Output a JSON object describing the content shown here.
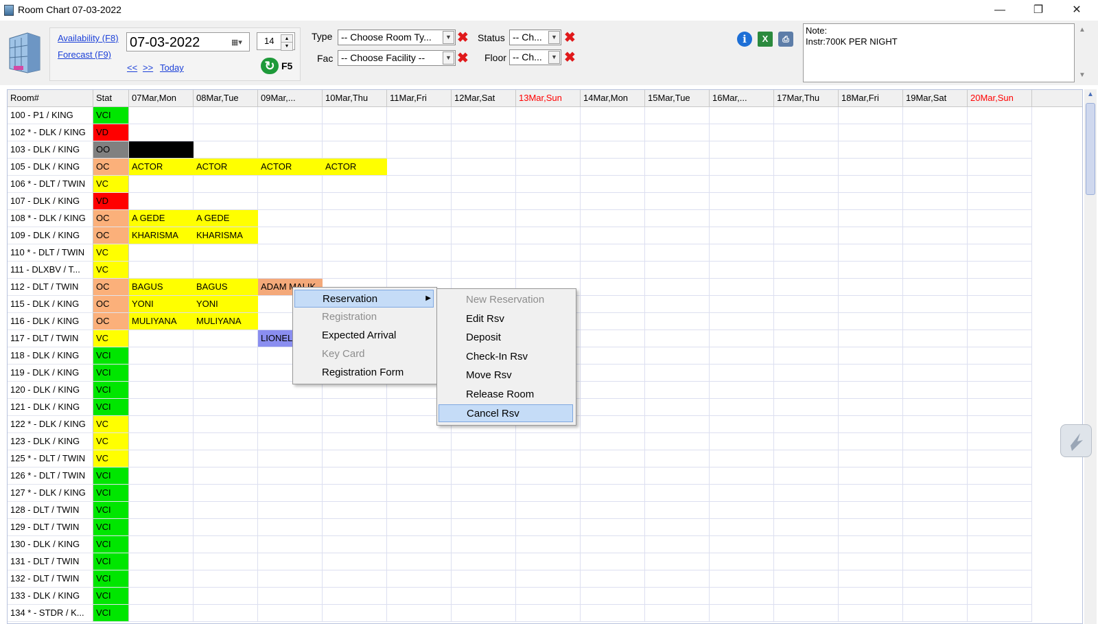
{
  "window": {
    "title": "Room Chart 07-03-2022",
    "minimize": "—",
    "restore": "❐",
    "close": "✕"
  },
  "toolbar": {
    "availability_link": "Availability (F8)",
    "forecast_link": "Forecast (F9)",
    "prev_link": "<<",
    "next_link": ">>",
    "today_link": "Today",
    "date_value": "07-03-2022",
    "days_value": "14",
    "refresh_label": "F5",
    "type_label": "Type",
    "type_value": "-- Choose Room Ty...",
    "fac_label": "Fac",
    "fac_value": "-- Choose Facility --",
    "status_label": "Status",
    "status_value": "-- Ch...",
    "floor_label": "Floor",
    "floor_value": "-- Ch...",
    "note_line1": "Note:",
    "note_line2": "Instr:700K PER NIGHT"
  },
  "grid": {
    "col_room": "Room#",
    "col_stat": "Stat",
    "dates": [
      {
        "label": "07Mar,Mon",
        "weekend": false
      },
      {
        "label": "08Mar,Tue",
        "weekend": false
      },
      {
        "label": "09Mar,...",
        "weekend": false
      },
      {
        "label": "10Mar,Thu",
        "weekend": false
      },
      {
        "label": "11Mar,Fri",
        "weekend": false
      },
      {
        "label": "12Mar,Sat",
        "weekend": false
      },
      {
        "label": "13Mar,Sun",
        "weekend": true
      },
      {
        "label": "14Mar,Mon",
        "weekend": false
      },
      {
        "label": "15Mar,Tue",
        "weekend": false
      },
      {
        "label": "16Mar,...",
        "weekend": false
      },
      {
        "label": "17Mar,Thu",
        "weekend": false
      },
      {
        "label": "18Mar,Fri",
        "weekend": false
      },
      {
        "label": "19Mar,Sat",
        "weekend": false
      },
      {
        "label": "20Mar,Sun",
        "weekend": true
      }
    ],
    "rows": [
      {
        "room": "100 - P1 / KING",
        "stat": "VCI"
      },
      {
        "room": "102 * - DLK / KING",
        "stat": "VD"
      },
      {
        "room": "103 - DLK / KING",
        "stat": "OO"
      },
      {
        "room": "105 - DLK / KING",
        "stat": "OC"
      },
      {
        "room": "106 * - DLT / TWIN",
        "stat": "VC"
      },
      {
        "room": "107 - DLK / KING",
        "stat": "VD"
      },
      {
        "room": "108 * - DLK / KING",
        "stat": "OC"
      },
      {
        "room": "109 - DLK / KING",
        "stat": "OC"
      },
      {
        "room": "110 * - DLT / TWIN",
        "stat": "VC"
      },
      {
        "room": "111 - DLXBV / T...",
        "stat": "VC"
      },
      {
        "room": "112 - DLT / TWIN",
        "stat": "OC"
      },
      {
        "room": "115 - DLK / KING",
        "stat": "OC"
      },
      {
        "room": "116 - DLK / KING",
        "stat": "OC"
      },
      {
        "room": "117 - DLT / TWIN",
        "stat": "VC"
      },
      {
        "room": "118 - DLK / KING",
        "stat": "VCI"
      },
      {
        "room": "119 - DLK / KING",
        "stat": "VCI"
      },
      {
        "room": "120 - DLK / KING",
        "stat": "VCI"
      },
      {
        "room": "121 - DLK / KING",
        "stat": "VCI"
      },
      {
        "room": "122 * - DLK / KING",
        "stat": "VC"
      },
      {
        "room": "123 - DLK / KING",
        "stat": "VC"
      },
      {
        "room": "125 * - DLT / TWIN",
        "stat": "VC"
      },
      {
        "room": "126 * - DLT / TWIN",
        "stat": "VCI"
      },
      {
        "room": "127 * - DLK / KING",
        "stat": "VCI"
      },
      {
        "room": "128 - DLT / TWIN",
        "stat": "VCI"
      },
      {
        "room": "129 - DLT / TWIN",
        "stat": "VCI"
      },
      {
        "room": "130 - DLK / KING",
        "stat": "VCI"
      },
      {
        "room": "131 - DLT / TWIN",
        "stat": "VCI"
      },
      {
        "room": "132 - DLT / TWIN",
        "stat": "VCI"
      },
      {
        "room": "133 - DLK / KING",
        "stat": "VCI"
      },
      {
        "room": "134 * - STDR / K...",
        "stat": "VCI"
      }
    ],
    "bookings": [
      {
        "row": 2,
        "col": 0,
        "span": 1,
        "label": "",
        "color": "#000000"
      },
      {
        "row": 3,
        "col": 0,
        "span": 1,
        "label": "ACTOR",
        "color": "#ffff00"
      },
      {
        "row": 3,
        "col": 1,
        "span": 1,
        "label": "ACTOR",
        "color": "#ffff00"
      },
      {
        "row": 3,
        "col": 2,
        "span": 1,
        "label": "ACTOR",
        "color": "#ffff00"
      },
      {
        "row": 3,
        "col": 3,
        "span": 1,
        "label": "ACTOR",
        "color": "#ffff00"
      },
      {
        "row": 6,
        "col": 0,
        "span": 1,
        "label": "A GEDE",
        "color": "#ffff00"
      },
      {
        "row": 6,
        "col": 1,
        "span": 1,
        "label": "A GEDE",
        "color": "#ffff00"
      },
      {
        "row": 7,
        "col": 0,
        "span": 1,
        "label": "KHARISMA",
        "color": "#ffff00"
      },
      {
        "row": 7,
        "col": 1,
        "span": 1,
        "label": "KHARISMA",
        "color": "#ffff00"
      },
      {
        "row": 10,
        "col": 0,
        "span": 1,
        "label": "BAGUS",
        "color": "#ffff00"
      },
      {
        "row": 10,
        "col": 1,
        "span": 1,
        "label": "BAGUS",
        "color": "#ffff00"
      },
      {
        "row": 10,
        "col": 2,
        "span": 1,
        "label": "ADAM MALIK",
        "color": "#f4a97a"
      },
      {
        "row": 11,
        "col": 0,
        "span": 1,
        "label": "YONI",
        "color": "#ffff00"
      },
      {
        "row": 11,
        "col": 1,
        "span": 1,
        "label": "YONI",
        "color": "#ffff00"
      },
      {
        "row": 12,
        "col": 0,
        "span": 1,
        "label": "MULIYANA",
        "color": "#ffff00"
      },
      {
        "row": 12,
        "col": 1,
        "span": 1,
        "label": "MULIYANA",
        "color": "#ffff00"
      },
      {
        "row": 13,
        "col": 2,
        "span": 1,
        "label": "LIONEL",
        "color": "#8a8ef0"
      }
    ]
  },
  "status_colors": {
    "VCI": "#00e600",
    "VD": "#ff0000",
    "OO": "#808080",
    "OC": "#fbb07a",
    "VC": "#ffff00"
  },
  "context_menu": {
    "items": [
      {
        "label": "Reservation",
        "disabled": false,
        "highlighted": true,
        "submenu": true
      },
      {
        "label": "Registration",
        "disabled": true
      },
      {
        "label": "Expected Arrival",
        "disabled": false
      },
      {
        "label": "Key Card",
        "disabled": true
      },
      {
        "label": "Registration Form",
        "disabled": false
      }
    ]
  },
  "submenu": {
    "items": [
      {
        "label": "New Reservation",
        "disabled": true
      },
      {
        "label": "Edit Rsv",
        "disabled": false
      },
      {
        "label": "Deposit",
        "disabled": false
      },
      {
        "label": "Check-In Rsv",
        "disabled": false
      },
      {
        "label": "Move Rsv",
        "disabled": false
      },
      {
        "label": "Release Room",
        "disabled": false
      },
      {
        "label": "Cancel Rsv",
        "disabled": false,
        "highlighted": true
      }
    ]
  },
  "icons": {
    "info": "info-icon",
    "excel": "excel-icon",
    "print": "printer-icon",
    "weekend_color": "#ff0000"
  }
}
